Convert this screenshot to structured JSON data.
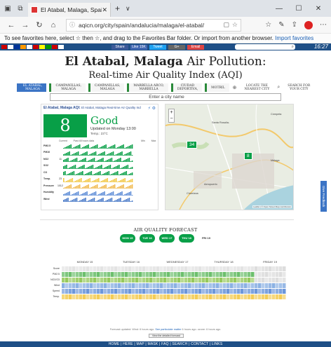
{
  "browser": {
    "tab_title": "El Atabal, Malaga, Spair",
    "url": "aqicn.org/city/spain/andalucia/malaga/el-atabal/",
    "favbar_text": "To see favorites here, select ☆ then ☆, and drag to the Favorites Bar folder. Or import from another browser.",
    "favbar_link": "Import favorites"
  },
  "site": {
    "time": "16:27",
    "socials": [
      "Share",
      "Like 15K",
      "Tweet",
      "G+",
      "Email"
    ],
    "title_bold": "El Atabal, Malaga",
    "title_rest": "Air Pollution:",
    "subtitle": "Real-time Air Quality Index (AQI)",
    "nav": [
      {
        "l1": "EL ATABAL,",
        "l2": "MALAGA"
      },
      {
        "l1": "CAMPANILLAS,",
        "l2": "MALAGA"
      },
      {
        "l1": "CAMPANILLAS,",
        "l2": "MALAGA"
      },
      {
        "l1": "MARBELLA ARCO,",
        "l2": "MARBELLA"
      },
      {
        "l1": "CIUDAD",
        "l2": "DEPORTIVA,"
      },
      {
        "l1": "MOTRIL",
        "l2": ""
      },
      {
        "l1": "LOCATE THE",
        "l2": "NEAREST CITY"
      },
      {
        "l1": "SEARCH FOR",
        "l2": "YOUR CITY"
      }
    ],
    "city_placeholder": "Enter a city name"
  },
  "aqi": {
    "header": "El Atabal, Malaga AQI:",
    "header_small": "El Atabal, Malaga Real-time Air Quality Ind",
    "value": "8",
    "status": "Good",
    "updated": "Updated on Monday 13:00",
    "temp": "Temp.: 23°C",
    "chart_head": [
      "Current",
      "Past 48 hours data",
      "Min",
      "Max"
    ],
    "rows": [
      {
        "label": "PM2.5",
        "cur": "",
        "min": "",
        "max": "",
        "color": "#089f47"
      },
      {
        "label": "PM10",
        "cur": "",
        "min": "",
        "max": "",
        "color": "#089f47"
      },
      {
        "label": "NO2",
        "cur": "11",
        "min": "",
        "max": "",
        "color": "#089f47"
      },
      {
        "label": "SO2",
        "cur": "",
        "min": "",
        "max": "",
        "color": "#089f47"
      },
      {
        "label": "CO",
        "cur": "",
        "min": "",
        "max": "",
        "color": "#089f47"
      },
      {
        "label": "Temp.",
        "cur": "23",
        "min": "",
        "max": "",
        "color": "#f2c744"
      },
      {
        "label": "Pressure",
        "cur": "1012",
        "min": "",
        "max": "",
        "color": "#f0b84c"
      },
      {
        "label": "Humidity",
        "cur": "",
        "min": "",
        "max": "",
        "color": "#5b8bd6"
      },
      {
        "label": "Wind",
        "cur": "",
        "min": "",
        "max": "",
        "color": "#4a7ac8"
      }
    ]
  },
  "map": {
    "markers": [
      "34",
      "8"
    ],
    "labels": [
      "Santa Rosalía-",
      "Aeropuerto",
      "Málaga",
      "Churriana",
      "Cómpeta"
    ],
    "attribution": "Leaflet | © Open Street Map contributors"
  },
  "feedback": "Give Feedback",
  "forecast": {
    "title": "AIR QUALITY FORECAST",
    "blobs": [
      {
        "label": "MON 15",
        "pct": "",
        "green": true
      },
      {
        "label": "TUE 16",
        "pct": "",
        "green": true
      },
      {
        "label": "WED 17",
        "pct": "",
        "green": true
      },
      {
        "label": "THU 18",
        "pct": "",
        "green": true
      },
      {
        "label": "FRI 19",
        "pct": "",
        "green": false
      }
    ],
    "days": [
      "MONDAY 15",
      "TUESDAY 16",
      "WEDNESDAY 17",
      "THURSDAY 18",
      "FRIDAY 19"
    ],
    "rows": [
      "Score",
      "PM2.5",
      "NO2/O3",
      "Wind",
      "Speed",
      "Temp."
    ],
    "note_prefix": "Forecast updated: Wind: 6 hours ago.",
    "note_link": "See particulate matter",
    "note_suffix": "6 hours ago. ozone: 6 hours ago.",
    "view_button": "View the detailed forecast"
  },
  "bottom_nav": "HOME | HERE | MAP | MASK | FAQ | SEARCH | CONTACT | LINKS"
}
